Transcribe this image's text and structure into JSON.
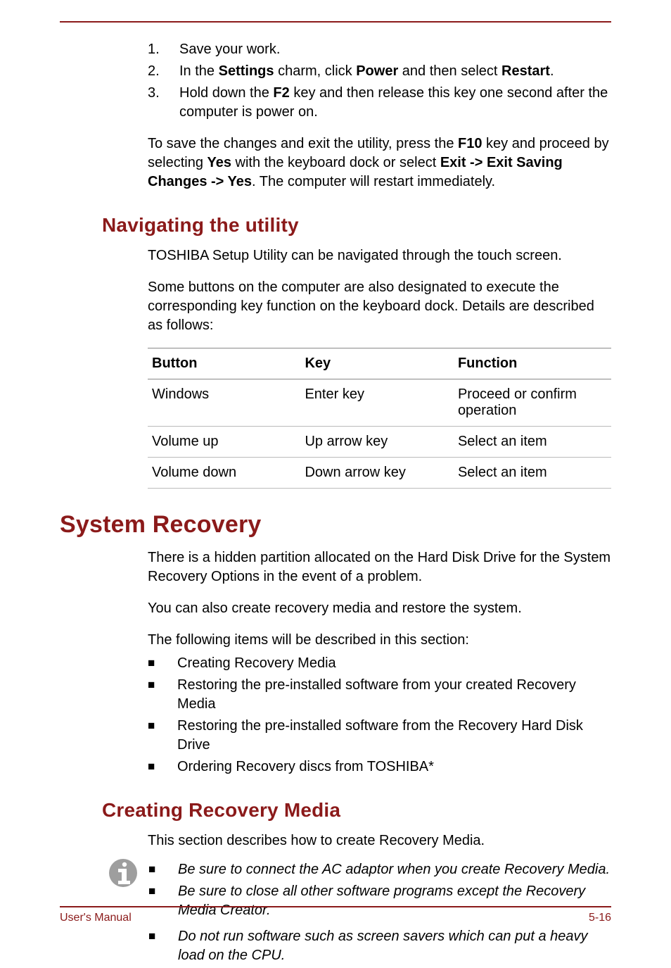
{
  "steps": {
    "n1": "1.",
    "t1": "Save your work.",
    "n2": "2.",
    "t2a": "In the ",
    "t2b": "Settings",
    "t2c": " charm, click ",
    "t2d": "Power",
    "t2e": " and then select ",
    "t2f": "Restart",
    "t2g": ".",
    "n3": "3.",
    "t3a": "Hold down the ",
    "t3b": "F2",
    "t3c": " key and then release this key one second after the computer is power on."
  },
  "para_save": {
    "a": "To save the changes and exit the utility, press the ",
    "b": "F10",
    "c": " key and proceed by selecting ",
    "d": "Yes",
    "e": " with the keyboard dock or select ",
    "f": "Exit -> Exit Saving Changes -> Yes",
    "g": ". The computer will restart immediately."
  },
  "nav": {
    "heading": "Navigating the utility",
    "p1": "TOSHIBA Setup Utility can be navigated through the touch screen.",
    "p2": "Some buttons on the computer are also designated to execute the corresponding key function on the keyboard dock. Details are described as follows:"
  },
  "table": {
    "h1": "Button",
    "h2": "Key",
    "h3": "Function",
    "r1c1": "Windows",
    "r1c2": "Enter key",
    "r1c3": "Proceed or confirm operation",
    "r2c1": "Volume up",
    "r2c2": "Up arrow key",
    "r2c3": "Select an item",
    "r3c1": "Volume down",
    "r3c2": "Down arrow key",
    "r3c3": "Select an item"
  },
  "sysrec": {
    "heading": "System Recovery",
    "p1": "There is a hidden partition allocated on the Hard Disk Drive for the System Recovery Options in the event of a problem.",
    "p2": "You can also create recovery media and restore the system.",
    "p3": "The following items will be described in this section:",
    "b1": "Creating Recovery Media",
    "b2": "Restoring the pre-installed software from your created Recovery Media",
    "b3": "Restoring the pre-installed software from the Recovery Hard Disk Drive",
    "b4": "Ordering Recovery discs from TOSHIBA*"
  },
  "crm": {
    "heading": "Creating Recovery Media",
    "p1": "This section describes how to create Recovery Media.",
    "n1": "Be sure to connect the AC adaptor when you create Recovery Media.",
    "n2": "Be sure to close all other software programs except the Recovery Media Creator.",
    "n3": "Do not run software such as screen savers which can put a heavy load on the CPU."
  },
  "footer": {
    "left": "User's Manual",
    "right": "5-16"
  },
  "glyph": {
    "square": "■"
  }
}
